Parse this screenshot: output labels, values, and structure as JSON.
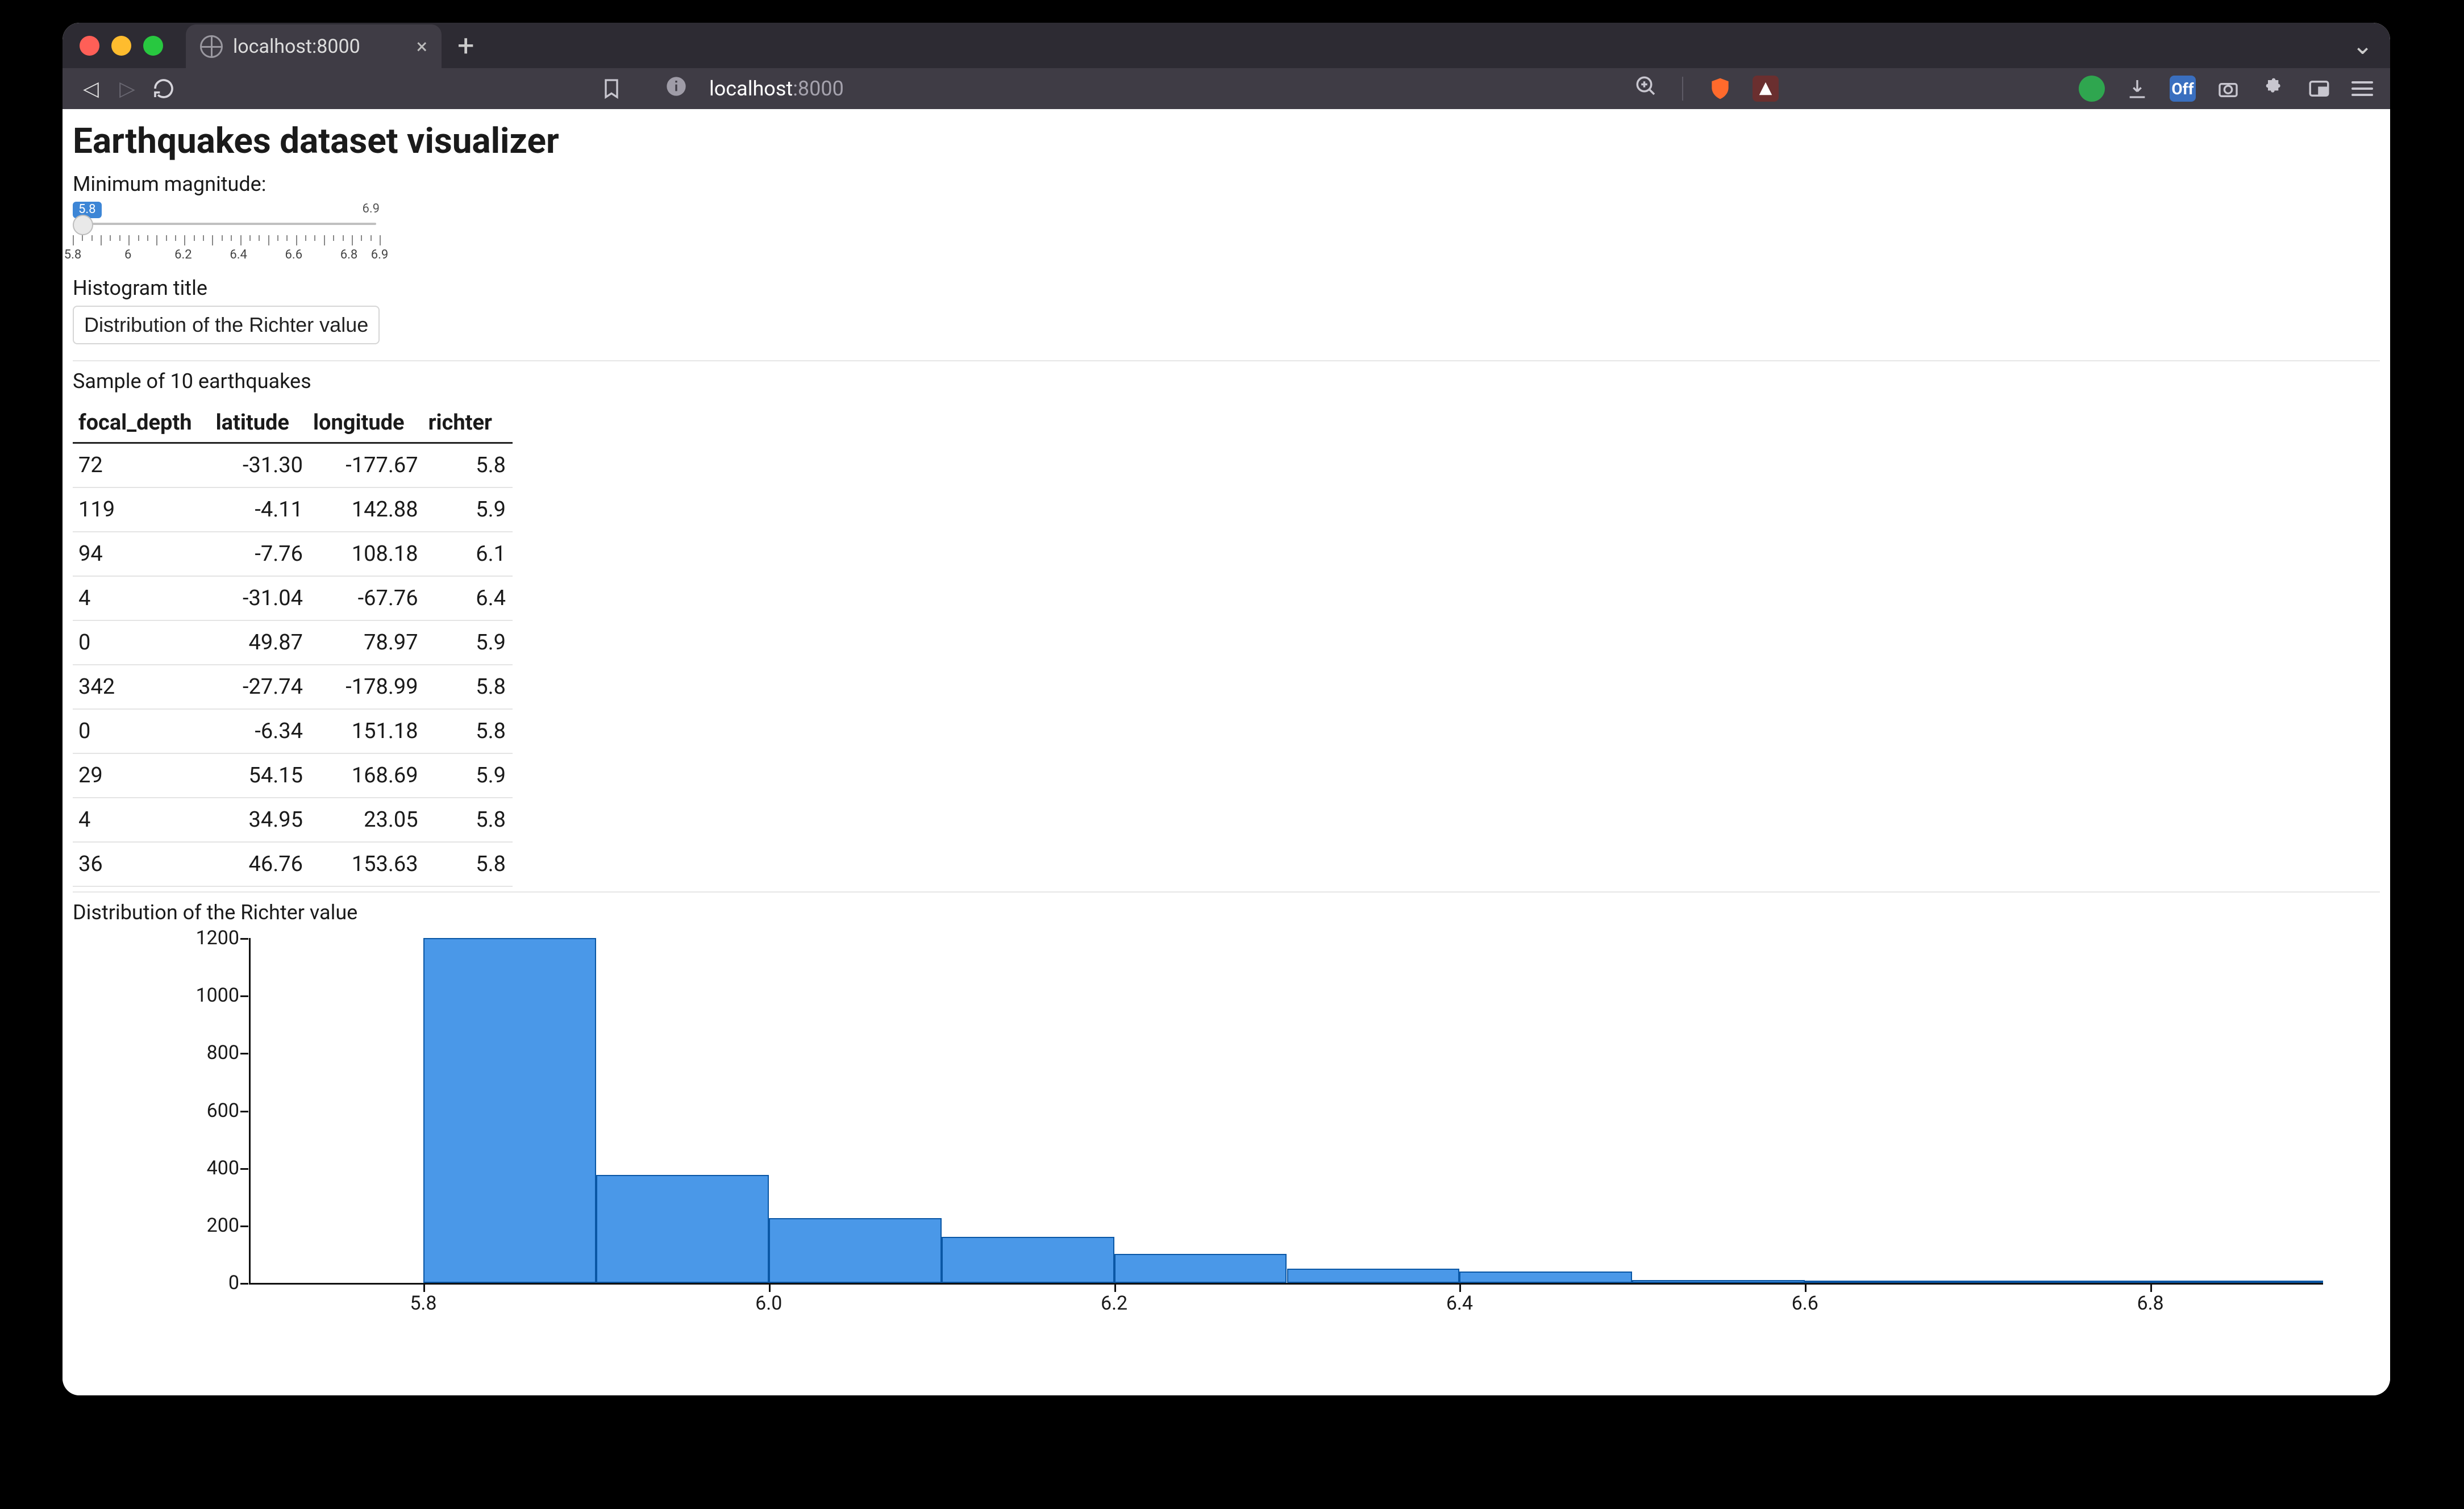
{
  "browser": {
    "tab_title": "localhost:8000",
    "url_host": "localhost",
    "url_port": ":8000"
  },
  "page": {
    "title": "Earthquakes dataset visualizer",
    "slider_label": "Minimum magnitude:",
    "slider": {
      "min_label": "5.8",
      "max_label": "6.9",
      "value_badge": "5.8",
      "tick_labels": [
        "5.8",
        "6",
        "6.2",
        "6.4",
        "6.6",
        "6.8",
        "6.9"
      ]
    },
    "hist_title_label": "Histogram title",
    "hist_title_value": "Distribution of the Richter value",
    "sample_label": "Sample of 10 earthquakes",
    "table": {
      "headers": [
        "focal_depth",
        "latitude",
        "longitude",
        "richter"
      ],
      "rows": [
        [
          "72",
          "-31.30",
          "-177.67",
          "5.8"
        ],
        [
          "119",
          "-4.11",
          "142.88",
          "5.9"
        ],
        [
          "94",
          "-7.76",
          "108.18",
          "6.1"
        ],
        [
          "4",
          "-31.04",
          "-67.76",
          "6.4"
        ],
        [
          "0",
          "49.87",
          "78.97",
          "5.9"
        ],
        [
          "342",
          "-27.74",
          "-178.99",
          "5.8"
        ],
        [
          "0",
          "-6.34",
          "151.18",
          "5.8"
        ],
        [
          "29",
          "54.15",
          "168.69",
          "5.9"
        ],
        [
          "4",
          "34.95",
          "23.05",
          "5.8"
        ],
        [
          "36",
          "46.76",
          "153.63",
          "5.8"
        ]
      ]
    },
    "chart_caption": "Distribution of the Richter value"
  },
  "chart_data": {
    "type": "bar",
    "title": "Distribution of the Richter value",
    "xlabel": "",
    "ylabel": "",
    "xlim": [
      5.7,
      6.9
    ],
    "ylim": [
      0,
      1200
    ],
    "x_ticks": [
      5.8,
      6.0,
      6.2,
      6.4,
      6.6,
      6.8
    ],
    "y_ticks": [
      0,
      200,
      400,
      600,
      800,
      1000,
      1200
    ],
    "bin_edges": [
      5.8,
      5.9,
      6.0,
      6.1,
      6.2,
      6.3,
      6.4,
      6.5,
      6.6,
      6.7,
      6.8,
      6.9
    ],
    "values": [
      1200,
      375,
      225,
      160,
      100,
      50,
      40,
      10,
      7,
      5,
      3
    ]
  }
}
